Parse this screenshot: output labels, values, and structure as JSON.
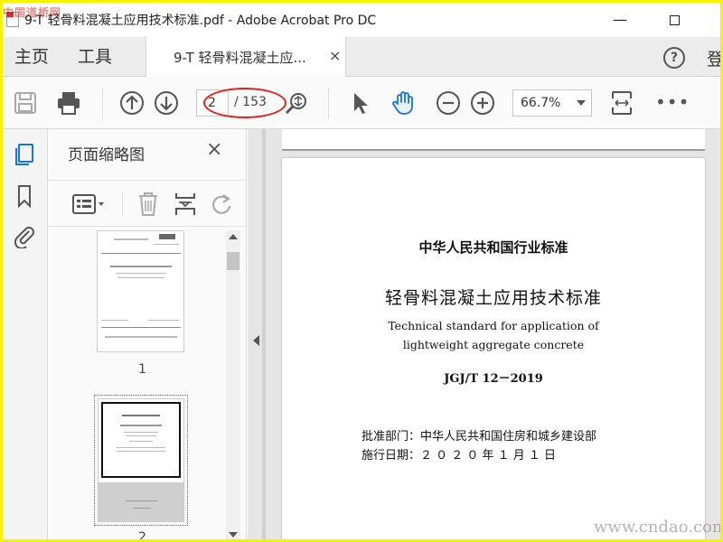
{
  "window": {
    "title": "9-T 轻骨料混凝土应用技术标准.pdf - Adobe Acrobat Pro DC",
    "minimize_symbol": "—",
    "watermark_logo": "中国道桥网"
  },
  "tabs": {
    "home": "主页",
    "tools": "工具",
    "document": "9-T 轻骨料混凝土应...",
    "close_symbol": "×",
    "help_symbol": "?",
    "login": "登"
  },
  "toolbar": {
    "page_current": "2",
    "page_total": "/ 153",
    "zoom": "66.7%",
    "more_symbol": "•••"
  },
  "thumbnails": {
    "title": "页面缩略图",
    "close_symbol": "×",
    "pages": [
      {
        "label": "1"
      },
      {
        "label": "2"
      }
    ]
  },
  "document": {
    "org": "中华人民共和国行业标准",
    "title": "轻骨料混凝土应用技术标准",
    "english_line1": "Technical standard for application of",
    "english_line2": "lightweight aggregate concrete",
    "code": "JGJ/T 12－2019",
    "approval": "批准部门：中华人民共和国住房和城乡建设部",
    "effective_date": "施行日期：２ ０ ２ ０ 年  １ 月  １ 日"
  },
  "footer": {
    "site_watermark": "www.cndao.com"
  },
  "colors": {
    "border_yellow": "#f5f500",
    "accent_blue": "#1473e6",
    "highlight_red": "#e0201c"
  }
}
